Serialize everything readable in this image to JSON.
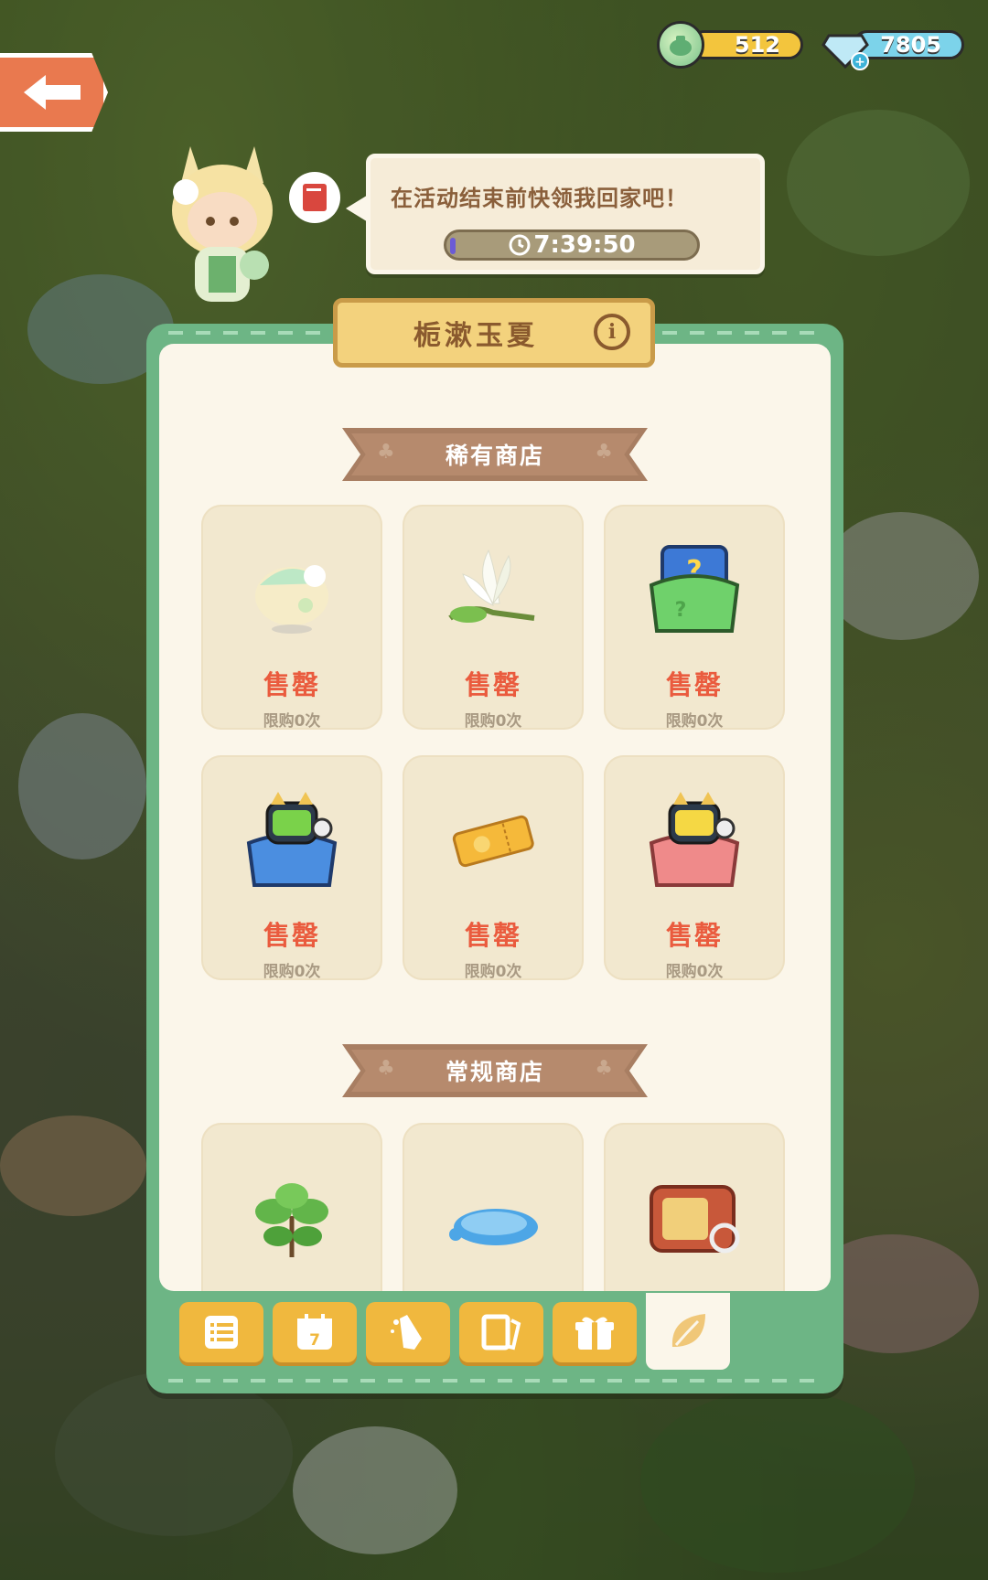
{
  "currency": {
    "coins": "512",
    "gems": "7805"
  },
  "icons": {
    "back": "back-arrow-icon",
    "coin": "teapot-coin-icon",
    "gem": "diamond-gem-icon",
    "book": "book-icon",
    "info": "info-icon",
    "timer": "clock-icon"
  },
  "bubble": {
    "message": "在活动结束前快领我回家吧！",
    "timer": "7:39:50"
  },
  "panel": {
    "title": "栀漱玉夏",
    "info_symbol": "i"
  },
  "rare_shop": {
    "title": "稀有商店",
    "items": [
      {
        "status": "售罄",
        "limit": "限购0次",
        "icon": "flower-bun-icon"
      },
      {
        "status": "售罄",
        "limit": "限购0次",
        "icon": "gardenia-flower-icon"
      },
      {
        "status": "售罄",
        "limit": "限购0次",
        "icon": "mystery-bag-icon"
      },
      {
        "status": "售罄",
        "limit": "限购0次",
        "icon": "robot-cat-bag-blue-icon"
      },
      {
        "status": "售罄",
        "limit": "限购0次",
        "icon": "gold-ticket-icon"
      },
      {
        "status": "售罄",
        "limit": "限购0次",
        "icon": "robot-cat-bag-red-icon"
      }
    ]
  },
  "regular_shop": {
    "title": "常规商店",
    "items": [
      {
        "icon": "leafy-plant-icon"
      },
      {
        "icon": "water-puddle-icon"
      },
      {
        "icon": "radio-box-icon"
      }
    ]
  },
  "tabs": [
    {
      "icon": "list-icon"
    },
    {
      "icon": "calendar-icon",
      "badge": "7"
    },
    {
      "icon": "hand-pointer-icon"
    },
    {
      "icon": "photo-frame-icon"
    },
    {
      "icon": "gift-box-icon"
    },
    {
      "icon": "leaf-icon",
      "active": true
    }
  ],
  "colors": {
    "panel_green": "#6db585",
    "sold_red": "#ea5b3e",
    "tab_yellow": "#f0b83e",
    "banner_brown": "#a87e62"
  }
}
